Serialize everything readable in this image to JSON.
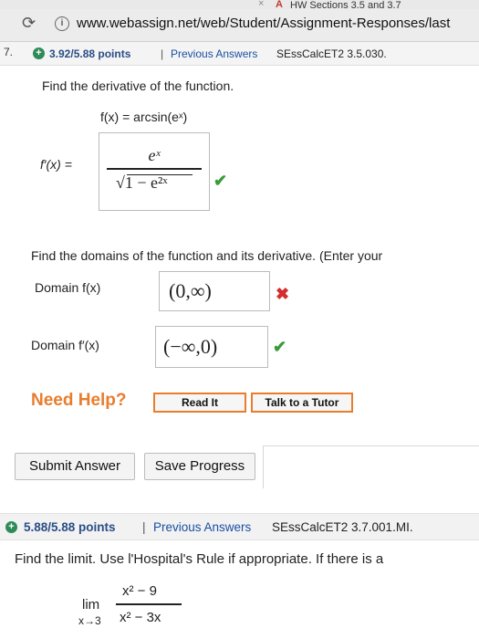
{
  "browser": {
    "tab_title": "HW Sections 3.5 and 3.7",
    "url": "www.webassign.net/web/Student/Assignment-Responses/last"
  },
  "question1": {
    "number": "7.",
    "points": "3.92/5.88 points",
    "separator": "|",
    "previous_answers": "Previous Answers",
    "code": "SEssCalcET2 3.5.030.",
    "prompt": "Find the derivative of the function.",
    "function": "f(x) = arcsin(eˣ)",
    "derivative_label": "f′(x) =",
    "derivative_answer": {
      "numerator": "eˣ",
      "denominator": "√1 − e²ˣ",
      "status": "correct"
    },
    "domain_prompt": "Find the domains of the function and its derivative. (Enter your",
    "domain_f": {
      "label": "Domain f(x)",
      "value": "(0,∞)",
      "status": "incorrect"
    },
    "domain_fprime": {
      "label": "Domain f′(x)",
      "value": "(−∞,0)",
      "status": "correct"
    },
    "need_help": "Need Help?",
    "read_it": "Read It",
    "talk_to_tutor": "Talk to a Tutor",
    "submit_answer": "Submit Answer",
    "save_progress": "Save Progress"
  },
  "question2": {
    "points": "5.88/5.88 points",
    "separator": "|",
    "previous_answers": "Previous Answers",
    "code": "SEssCalcET2 3.7.001.MI.",
    "prompt": "Find the limit. Use l'Hospital's Rule if appropriate. If there is a",
    "limit": {
      "lim": "lim",
      "sub": "x→3",
      "numerator": "x² − 9",
      "denominator": "x² − 3x"
    }
  },
  "colors": {
    "correct": "#3a9a3a",
    "incorrect": "#d32f2f",
    "help_orange": "#e87d2d",
    "points_blue": "#2a4d86"
  }
}
